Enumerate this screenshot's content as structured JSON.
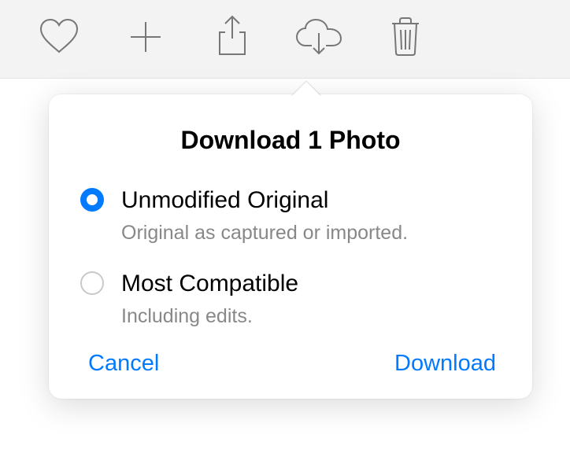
{
  "toolbar": {
    "icons": {
      "favorite": "heart-icon",
      "add": "plus-icon",
      "share": "share-icon",
      "download": "cloud-download-icon",
      "delete": "trash-icon"
    }
  },
  "popover": {
    "title": "Download 1 Photo",
    "options": [
      {
        "value": "unmodified",
        "label": "Unmodified Original",
        "description": "Original as captured or imported.",
        "selected": true
      },
      {
        "value": "compatible",
        "label": "Most Compatible",
        "description": "Including edits.",
        "selected": false
      }
    ],
    "actions": {
      "cancel": "Cancel",
      "confirm": "Download"
    },
    "colors": {
      "accent": "#007aff"
    }
  }
}
